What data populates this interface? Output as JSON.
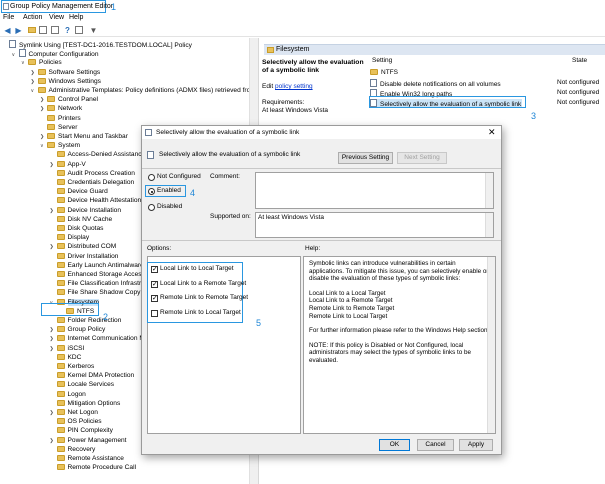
{
  "window": {
    "title": "Group Policy Management Editor",
    "menu": [
      "File",
      "Action",
      "View",
      "Help"
    ]
  },
  "callouts": [
    "1",
    "2",
    "3",
    "4",
    "5"
  ],
  "tree": [
    {
      "label": "Symlink Using [TEST-DC1-2016.TESTDOM.LOCAL] Policy",
      "indent": 0,
      "arrow": "",
      "icon": "doc"
    },
    {
      "label": "Computer Configuration",
      "indent": 1,
      "arrow": "open",
      "icon": "doc"
    },
    {
      "label": "Policies",
      "indent": 2,
      "arrow": "open",
      "icon": "folder"
    },
    {
      "label": "Software Settings",
      "indent": 3,
      "arrow": "closed",
      "icon": "folder"
    },
    {
      "label": "Windows Settings",
      "indent": 3,
      "arrow": "closed",
      "icon": "folder"
    },
    {
      "label": "Administrative Templates: Policy definitions (ADMX files) retrieved from the",
      "indent": 3,
      "arrow": "open",
      "icon": "folder"
    },
    {
      "label": "Control Panel",
      "indent": 4,
      "arrow": "closed",
      "icon": "folder"
    },
    {
      "label": "Network",
      "indent": 4,
      "arrow": "closed",
      "icon": "folder"
    },
    {
      "label": "Printers",
      "indent": 4,
      "arrow": "",
      "icon": "folder"
    },
    {
      "label": "Server",
      "indent": 4,
      "arrow": "",
      "icon": "folder"
    },
    {
      "label": "Start Menu and Taskbar",
      "indent": 4,
      "arrow": "closed",
      "icon": "folder"
    },
    {
      "label": "System",
      "indent": 4,
      "arrow": "open",
      "icon": "folder"
    },
    {
      "label": "Access-Denied Assistance",
      "indent": 5,
      "arrow": "",
      "icon": "folder"
    },
    {
      "label": "App-V",
      "indent": 5,
      "arrow": "closed",
      "icon": "folder"
    },
    {
      "label": "Audit Process Creation",
      "indent": 5,
      "arrow": "",
      "icon": "folder"
    },
    {
      "label": "Credentials Delegation",
      "indent": 5,
      "arrow": "",
      "icon": "folder"
    },
    {
      "label": "Device Guard",
      "indent": 5,
      "arrow": "",
      "icon": "folder"
    },
    {
      "label": "Device Health Attestation Se",
      "indent": 5,
      "arrow": "",
      "icon": "folder"
    },
    {
      "label": "Device Installation",
      "indent": 5,
      "arrow": "closed",
      "icon": "folder"
    },
    {
      "label": "Disk NV Cache",
      "indent": 5,
      "arrow": "",
      "icon": "folder"
    },
    {
      "label": "Disk Quotas",
      "indent": 5,
      "arrow": "",
      "icon": "folder"
    },
    {
      "label": "Display",
      "indent": 5,
      "arrow": "",
      "icon": "folder"
    },
    {
      "label": "Distributed COM",
      "indent": 5,
      "arrow": "closed",
      "icon": "folder"
    },
    {
      "label": "Driver Installation",
      "indent": 5,
      "arrow": "",
      "icon": "folder"
    },
    {
      "label": "Early Launch Antimalware",
      "indent": 5,
      "arrow": "",
      "icon": "folder"
    },
    {
      "label": "Enhanced Storage Access",
      "indent": 5,
      "arrow": "",
      "icon": "folder"
    },
    {
      "label": "File Classification Infrastruct",
      "indent": 5,
      "arrow": "",
      "icon": "folder"
    },
    {
      "label": "File Share Shadow Copy Pro",
      "indent": 5,
      "arrow": "",
      "icon": "folder"
    },
    {
      "label": "Filesystem",
      "indent": 5,
      "arrow": "open",
      "icon": "folder",
      "highlight": true
    },
    {
      "label": "NTFS",
      "indent": 6,
      "arrow": "",
      "icon": "folder"
    },
    {
      "label": "Folder Redirection",
      "indent": 5,
      "arrow": "",
      "icon": "folder"
    },
    {
      "label": "Group Policy",
      "indent": 5,
      "arrow": "closed",
      "icon": "folder"
    },
    {
      "label": "Internet Communication M",
      "indent": 5,
      "arrow": "closed",
      "icon": "folder"
    },
    {
      "label": "iSCSI",
      "indent": 5,
      "arrow": "closed",
      "icon": "folder"
    },
    {
      "label": "KDC",
      "indent": 5,
      "arrow": "",
      "icon": "folder"
    },
    {
      "label": "Kerberos",
      "indent": 5,
      "arrow": "",
      "icon": "folder"
    },
    {
      "label": "Kernel DMA Protection",
      "indent": 5,
      "arrow": "",
      "icon": "folder"
    },
    {
      "label": "Locale Services",
      "indent": 5,
      "arrow": "",
      "icon": "folder"
    },
    {
      "label": "Logon",
      "indent": 5,
      "arrow": "",
      "icon": "folder"
    },
    {
      "label": "Mitigation Options",
      "indent": 5,
      "arrow": "",
      "icon": "folder"
    },
    {
      "label": "Net Logon",
      "indent": 5,
      "arrow": "closed",
      "icon": "folder"
    },
    {
      "label": "OS Policies",
      "indent": 5,
      "arrow": "",
      "icon": "folder"
    },
    {
      "label": "PIN Complexity",
      "indent": 5,
      "arrow": "",
      "icon": "folder"
    },
    {
      "label": "Power Management",
      "indent": 5,
      "arrow": "closed",
      "icon": "folder"
    },
    {
      "label": "Recovery",
      "indent": 5,
      "arrow": "",
      "icon": "folder"
    },
    {
      "label": "Remote Assistance",
      "indent": 5,
      "arrow": "",
      "icon": "folder"
    },
    {
      "label": "Remote Procedure Call",
      "indent": 5,
      "arrow": "",
      "icon": "folder"
    }
  ],
  "right_panel": {
    "tab_label": "Filesystem",
    "desc_title": "Selectively allow the evaluation of a symbolic link",
    "edit_prefix": "Edit",
    "edit_link": "policy setting",
    "requirements_label": "Requirements:",
    "requirements_value": "At least Windows Vista",
    "col_setting": "Setting",
    "col_state": "State",
    "rows": [
      {
        "name": "NTFS",
        "state": ""
      },
      {
        "name": "Disable delete notifications on all volumes",
        "state": "Not configured"
      },
      {
        "name": "Enable Win32 long paths",
        "state": "Not configured"
      },
      {
        "name": "Selectively allow the evaluation of a symbolic link",
        "state": "Not configured"
      }
    ]
  },
  "dialog": {
    "title": "Selectively allow the evaluation of a symbolic link",
    "heading": "Selectively allow the evaluation of a symbolic link",
    "prev_button": "Previous Setting",
    "next_button": "Next Setting",
    "radio_not_configured": "Not Configured",
    "radio_enabled": "Enabled",
    "radio_disabled": "Disabled",
    "selected": "Enabled",
    "comment_label": "Comment:",
    "supported_label": "Supported on:",
    "supported_value": "At least Windows Vista",
    "options_label": "Options:",
    "help_label": "Help:",
    "options": [
      {
        "label": "Local Link to Local Target",
        "checked": true
      },
      {
        "label": "Local Link to a Remote Target",
        "checked": true
      },
      {
        "label": "Remote Link to Remote Target",
        "checked": true
      },
      {
        "label": "Remote Link to Local Target",
        "checked": false
      }
    ],
    "help_paragraphs": [
      "Symbolic links can introduce vulnerabilities in certain applications. To mitigate this issue, you can selectively enable or disable the evaluation of these types of symbolic links:",
      "Local Link to a Local Target\nLocal Link to a Remote Target\nRemote Link to Remote Target\nRemote Link to Local Target",
      "For further information please refer to the Windows Help section",
      "NOTE: If this policy is Disabled or Not Configured, local administrators may select the types of symbolic links to be evaluated."
    ],
    "ok_button": "OK",
    "cancel_button": "Cancel",
    "apply_button": "Apply"
  }
}
